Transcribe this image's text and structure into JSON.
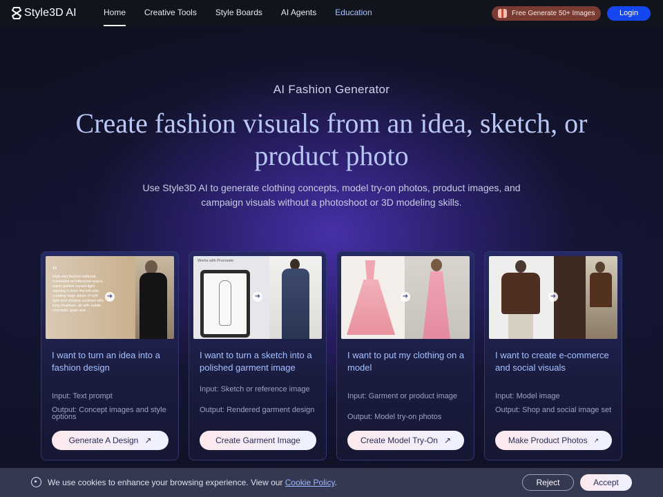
{
  "nav": {
    "logo": "Style3D AI",
    "links": [
      "Home",
      "Creative Tools",
      "Style Boards",
      "AI Agents",
      "Education"
    ],
    "promo": "Free Generate 50+ Images",
    "login": "Login"
  },
  "hero": {
    "eyebrow": "AI Fashion Generator",
    "headline": "Create fashion visuals from an idea, sketch, or product photo",
    "sub": "Use Style3D AI to generate clothing concepts, model try-on photos, product images, and campaign visuals without a photoshoot or 3D modeling skills."
  },
  "cards": [
    {
      "title": "I want to turn an idea into a fashion design",
      "input": "Input: Text prompt",
      "output": "Output: Concept images and style options",
      "button": "Generate A Design",
      "quote": "High-end fashion editorial, minimalist architectural space, warm golden sunset light slanting in from the left side, creating large areas of soft light and shadow contrast with long shadows, air with subtle cinematic grain and ..."
    },
    {
      "title": "I want to turn a sketch into a polished garment image",
      "input": "Input: Sketch or reference image",
      "output": "Output: Rendered garment design",
      "button": "Create Garment Image",
      "badge": "Works with Procreate"
    },
    {
      "title": "I want to put my clothing on a model",
      "input": "Input: Garment or product image",
      "output": "Output: Model try-on photos",
      "button": "Create Model Try-On"
    },
    {
      "title": "I want to create e-commerce and social visuals",
      "input": "Input: Model image",
      "output": "Output: Shop and social image set",
      "button": "Make Product Photos"
    }
  ],
  "cookie": {
    "text": "We use cookies to enhance your browsing experience. View our ",
    "link": "Cookie Policy",
    "period": ".",
    "reject": "Reject",
    "accept": "Accept"
  },
  "icons": [
    "style3d-logo-icon",
    "gift-icon",
    "arrow-icon",
    "external-arrow-icon",
    "cookie-icon"
  ]
}
